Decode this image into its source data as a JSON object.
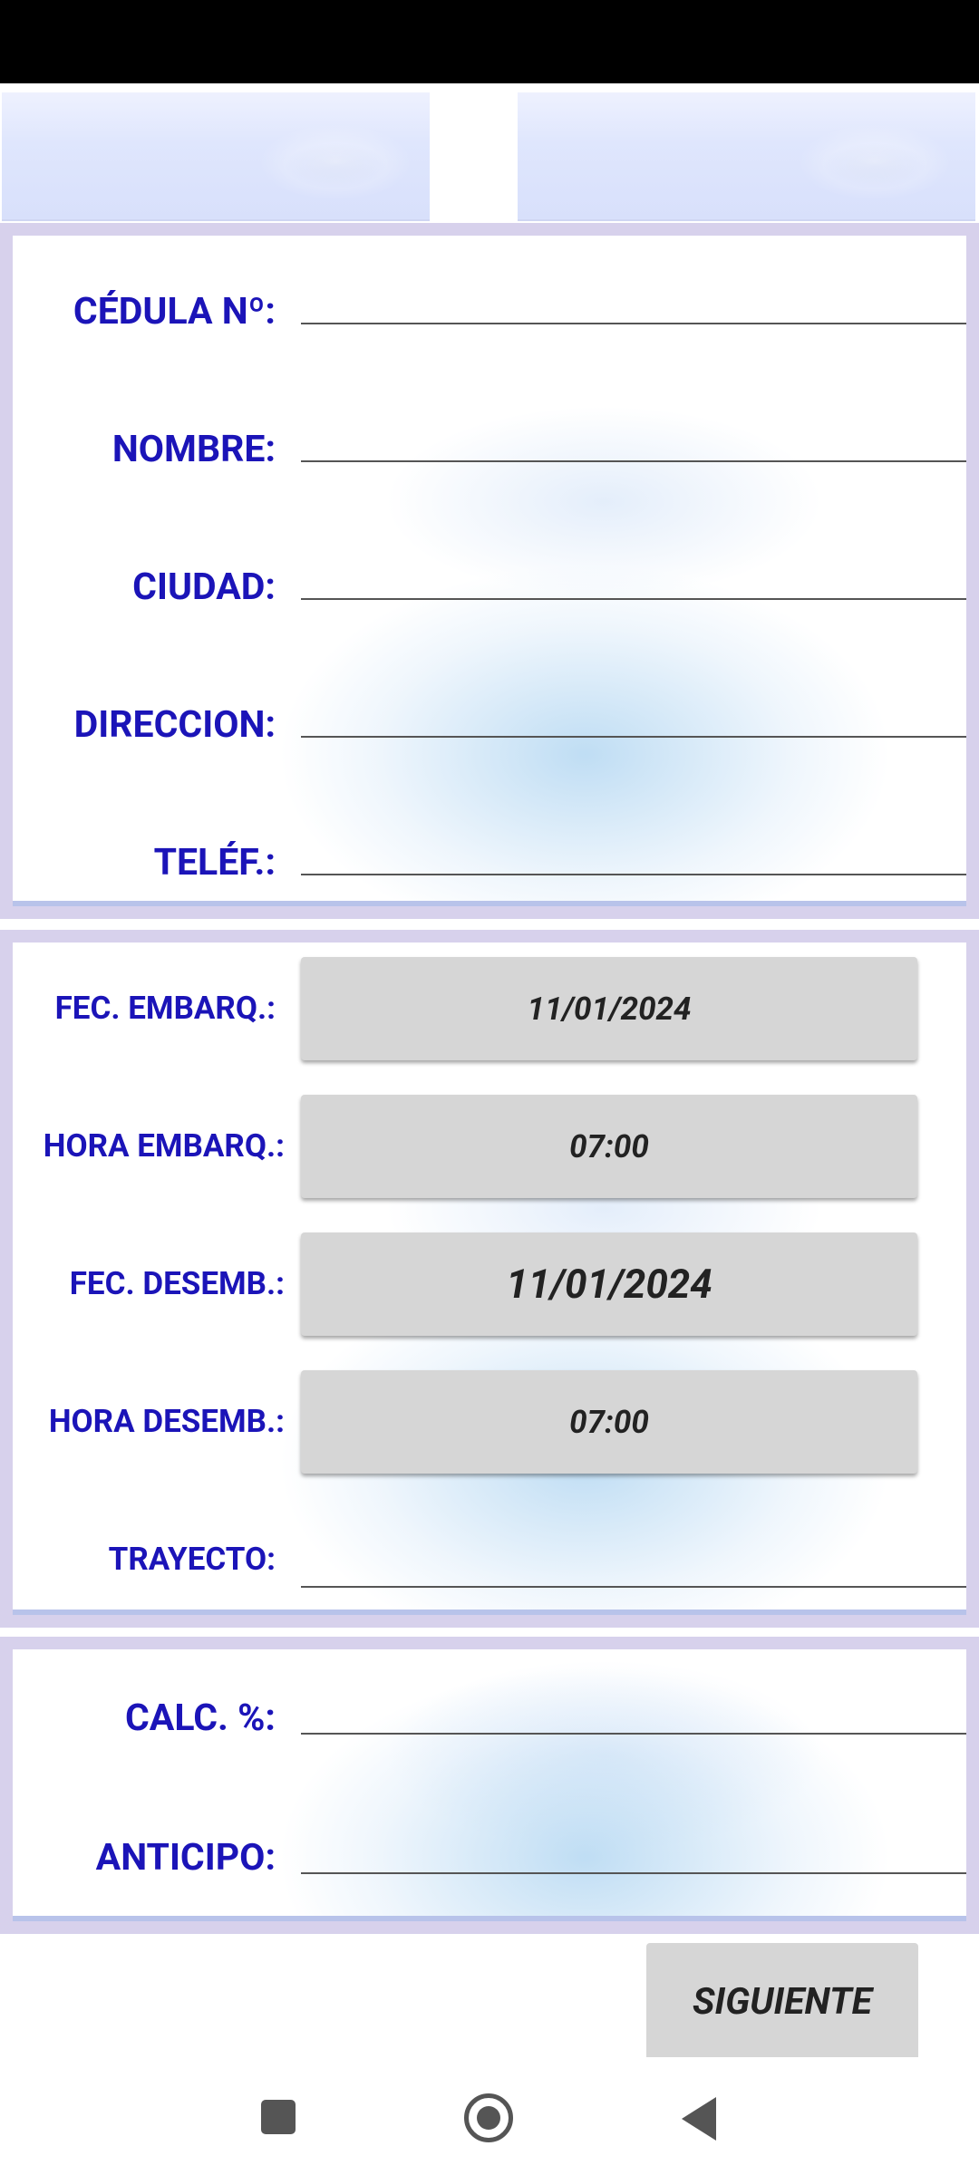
{
  "personal_section": {
    "cedula_label": "CÉDULA Nº:",
    "nombre_label": "NOMBRE:",
    "ciudad_label": "CIUDAD:",
    "direccion_label": "DIRECCION:",
    "telefono_label": "TELÉF.:"
  },
  "trip_section": {
    "fec_embarque_label": "FEC. EMBARQ.:",
    "fec_embarque_value": "11/01/2024",
    "hora_embarque_label": "HORA EMBARQ.:",
    "hora_embarque_value": "07:00",
    "fec_desembarque_label": "FEC. DESEMB.:",
    "fec_desembarque_value": "11/01/2024",
    "hora_desembarque_label": "HORA DESEMB.:",
    "hora_desembarque_value": "07:00",
    "trayecto_label": "TRAYECTO:"
  },
  "calc_section": {
    "calc_label": "CALC. %:",
    "anticipo_label": "ANTICIPO:"
  },
  "actions": {
    "next_label": "SIGUIENTE"
  },
  "navigation": {
    "recents_icon": "square-icon",
    "home_icon": "circle-icon",
    "back_icon": "triangle-back-icon"
  }
}
